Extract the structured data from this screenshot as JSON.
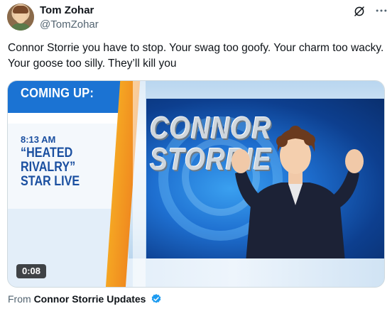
{
  "author": {
    "name": "Tom Zohar",
    "handle": "@TomZohar"
  },
  "tweet": {
    "text": "Connor Storrie you have to stop. Your swag too goofy. Your charm too wacky. Your goose too silly. They’ll kill you"
  },
  "media": {
    "banner": "COMING UP:",
    "time": "8:13 AM",
    "headline": "“HEATED\nRIVALRY”\nSTAR LIVE",
    "show_title": "CONNOR\nSTORRIE",
    "duration": "0:08",
    "icons": {
      "grok": "grok-icon",
      "more": "more-icon",
      "verified": "verified-badge-icon"
    }
  },
  "footer": {
    "prefix": "From",
    "source": "Connor Storrie Updates"
  },
  "colors": {
    "text_primary": "#0f1419",
    "text_secondary": "#536471",
    "verified": "#1d9bf0",
    "broadcast_orange": "#f5a623",
    "broadcast_blue": "#1b73d3"
  }
}
